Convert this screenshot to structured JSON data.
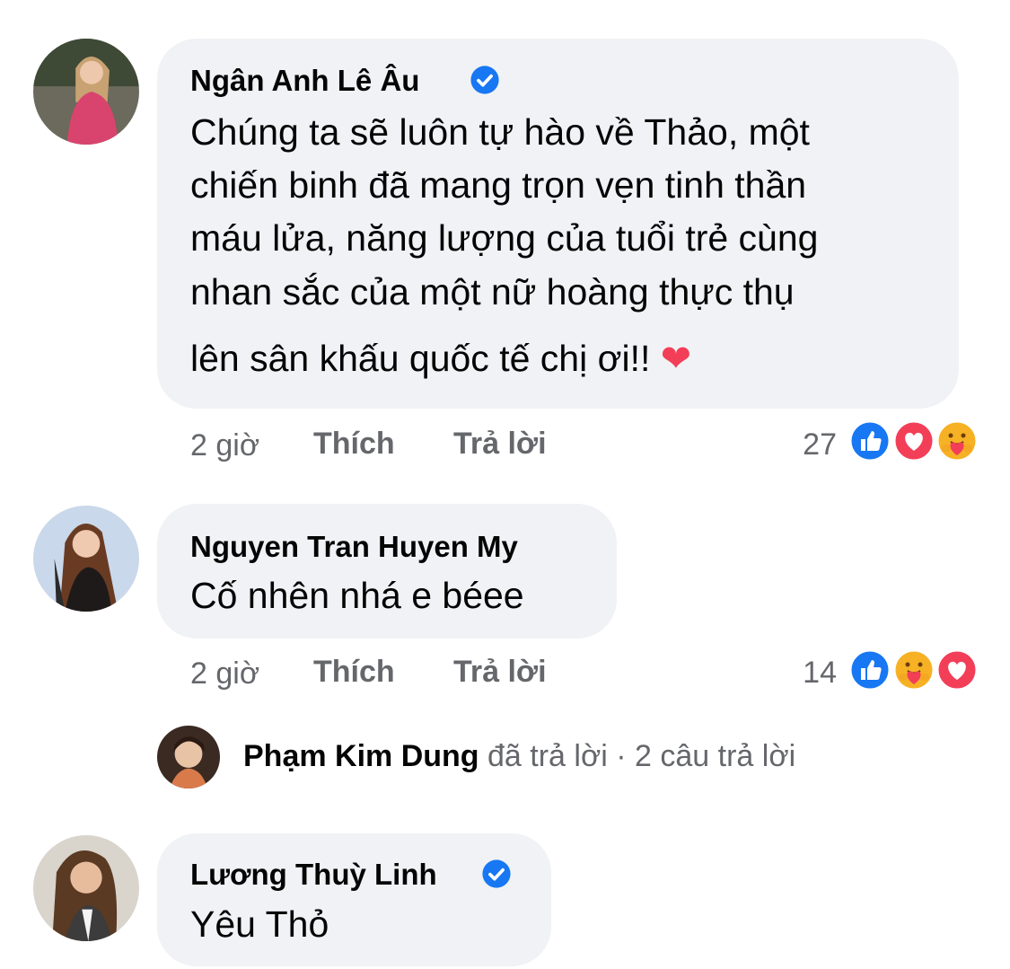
{
  "comments": [
    {
      "author": "Ngân Anh Lê Âu",
      "verified": true,
      "lines": [
        "Chúng ta sẽ luôn tự hào về Thảo, một",
        "chiến binh đã mang trọn vẹn tinh thần",
        "máu lửa, năng lượng của tuổi trẻ cùng",
        "nhan sắc của một nữ hoàng thực thụ",
        "lên sân khấu quốc tế chị ơi!! ❤"
      ],
      "time": "2 giờ",
      "like_label": "Thích",
      "reply_label": "Trả lời",
      "reaction_count": "27",
      "reactions": [
        "like-icon",
        "love-icon",
        "care-icon"
      ]
    },
    {
      "author": "Nguyen Tran Huyen My",
      "verified": false,
      "text": "Cố nhên nhá e béee",
      "time": "2 giờ",
      "like_label": "Thích",
      "reply_label": "Trả lời",
      "reaction_count": "14",
      "reactions": [
        "like-icon",
        "care-icon",
        "love-icon"
      ],
      "reply_summary": {
        "name": "Phạm Kim Dung",
        "action": " đã trả lời · 2 câu trả lời"
      }
    },
    {
      "author": "Lương Thuỳ Linh",
      "verified": true,
      "text": "Yêu Thỏ"
    }
  ],
  "colors": {
    "bubble": "#f0f2f5",
    "meta": "#65676b",
    "text": "#050505",
    "like": "#1877f2",
    "love": "#f33e58",
    "care": "#f7b125",
    "verified": "#1877f2"
  }
}
